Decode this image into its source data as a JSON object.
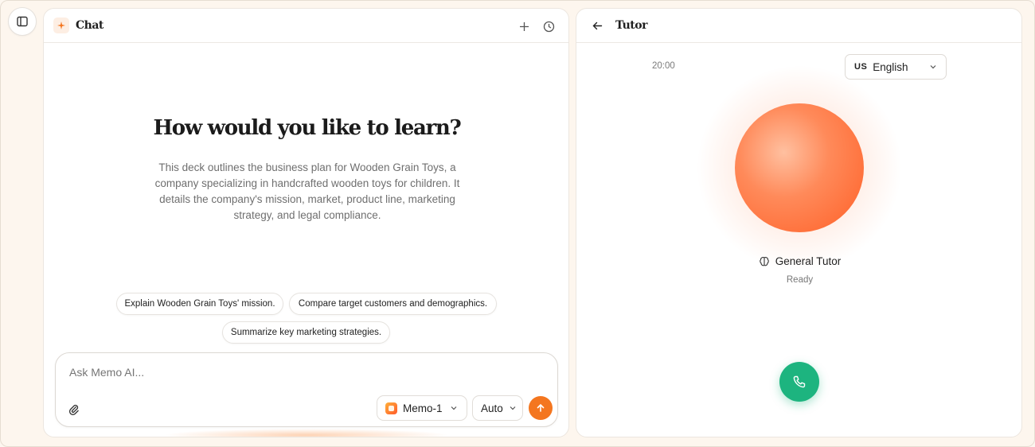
{
  "chat": {
    "title": "Chat",
    "headline": "How would you like to learn?",
    "description": "This deck outlines the business plan for Wooden Grain Toys, a company specializing in handcrafted wooden toys for children. It details the company's mission, market, product line, marketing strategy, and legal compliance.",
    "suggestions": [
      "Explain Wooden Grain Toys' mission.",
      "Compare target customers and demographics.",
      "Summarize key marketing strategies."
    ],
    "input": {
      "placeholder": "Ask Memo AI..."
    },
    "model_select": "Memo-1",
    "mode_select": "Auto",
    "accent_color": "#f4761f"
  },
  "tutor": {
    "title": "Tutor",
    "timer": "20:00",
    "language": {
      "flag": "US",
      "label": "English"
    },
    "name": "General Tutor",
    "status": "Ready",
    "call_color": "#1db47f"
  },
  "icons": [
    "sidebar-toggle-icon",
    "sparkle-icon",
    "plus-icon",
    "clock-icon",
    "paperclip-icon",
    "chevron-down-icon",
    "arrow-up-icon",
    "arrow-left-icon",
    "brain-icon",
    "phone-icon"
  ]
}
